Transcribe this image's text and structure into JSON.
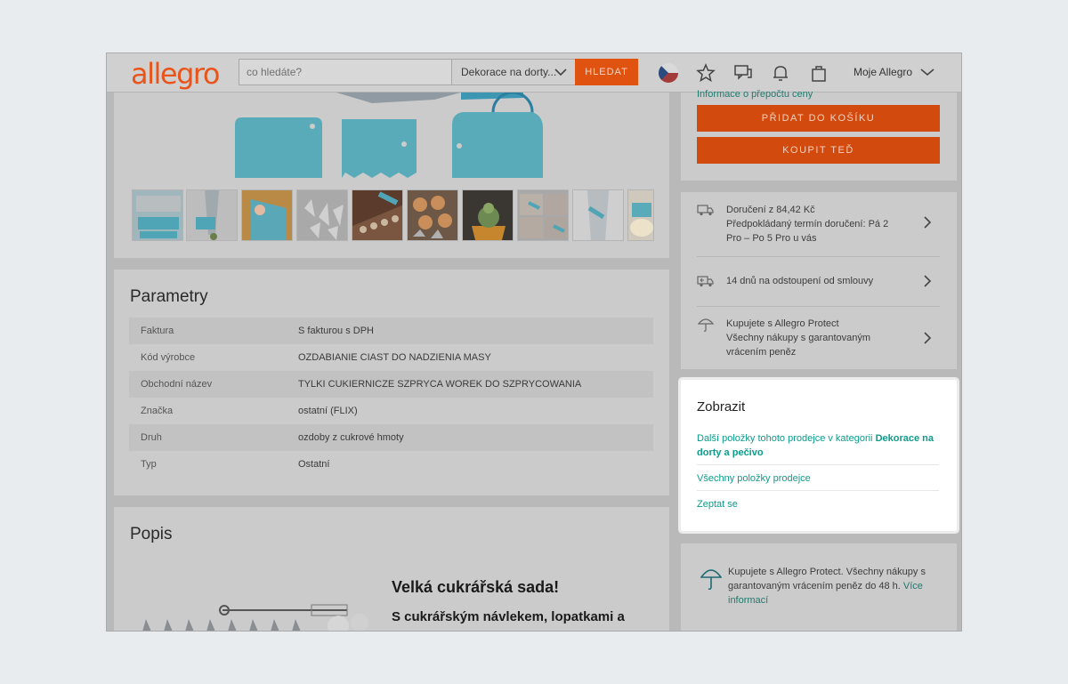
{
  "header": {
    "logo": "allegro",
    "search_placeholder": "co hledáte?",
    "category": "Dekorace na dorty...",
    "search_button": "HLEDAT",
    "account": "Moje Allegro"
  },
  "gallery": {
    "thumb_count": 10
  },
  "parameters": {
    "title": "Parametry",
    "rows": [
      {
        "key": "Faktura",
        "value": "S fakturou s DPH"
      },
      {
        "key": "Kód výrobce",
        "value": "OZDABIANIE CIAST DO NADZIENIA MASY"
      },
      {
        "key": "Obchodní název",
        "value": "TYLKI CUKIERNICZE SZPRYCA WOREK DO SZPRYCOWANIA"
      },
      {
        "key": "Značka",
        "value": "ostatní (FLIX)"
      },
      {
        "key": "Druh",
        "value": "ozdoby z cukrové hmoty"
      },
      {
        "key": "Typ",
        "value": "Ostatní"
      }
    ]
  },
  "description": {
    "title": "Popis",
    "heading": "Velká cukrářská sada!",
    "text": "S cukrářským návlekem, lopatkami a"
  },
  "buy_box": {
    "price_info_link": "Informace o přepočtu ceny",
    "add_to_cart": "PŘIDAT DO KOŠÍKU",
    "buy_now": "KOUPIT TEĎ"
  },
  "delivery": {
    "shipping_line1": "Doručení z 84,42 Kč",
    "shipping_line2": "Předpokládaný termín doručení: Pá 2",
    "shipping_line3": "Pro – Po 5 Pro u vás",
    "returns": "14 dnů na odstoupení od smlouvy",
    "protect_line1": "Kupujete s Allegro Protect",
    "protect_line2": "Všechny nákupy s garantovaným",
    "protect_line3": "vrácením peněz"
  },
  "show_panel": {
    "title": "Zobrazit",
    "link1_prefix": "Další položky tohoto prodejce v kategorii ",
    "link1_bold": "Dekorace na dorty a pečivo",
    "link2": "Všechny položky prodejce",
    "link3": "Zeptat se"
  },
  "protect_banner": {
    "text": "Kupujete s Allegro Protect. Všechny nákupy s garantovaným vrácením peněz do 48 h.",
    "link": "Více informací"
  },
  "colors": {
    "brand_orange": "#ff5a00",
    "link_teal": "#00a790"
  }
}
